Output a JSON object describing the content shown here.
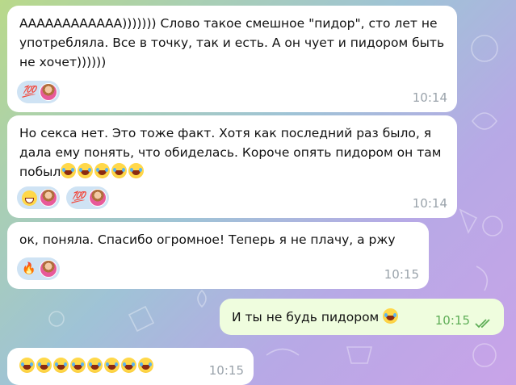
{
  "chat": {
    "messages": [
      {
        "direction": "incoming",
        "text": "АААААААААААА))))))) Слово такое смешное \"пидор\", сто лет не употребляла. Все в точку, так и есть. А он чует и пидором быть не хочет))))))",
        "reactions": [
          {
            "emoji_icon": "hundred-points-icon",
            "glyph": "💯"
          }
        ],
        "time": "10:14"
      },
      {
        "direction": "incoming",
        "text": "Но секса нет. Это тоже факт. Хотя как последний раз было, я дала ему понять, что обиделась. Короче опять пидором он там побыл",
        "trailing_emoji": {
          "icon": "face-with-tears-of-joy-icon",
          "count": 5
        },
        "reactions": [
          {
            "emoji_icon": "grinning-face-icon",
            "glyph": "😁"
          },
          {
            "emoji_icon": "hundred-points-icon",
            "glyph": "💯"
          }
        ],
        "time": "10:14"
      },
      {
        "direction": "incoming",
        "text": "ок, поняла. Спасибо огромное! Теперь я не плачу, а ржу",
        "reactions": [
          {
            "emoji_icon": "fire-icon",
            "glyph": "🔥"
          }
        ],
        "time": "10:15"
      },
      {
        "direction": "outgoing",
        "text": "И ты не будь пидором",
        "trailing_emoji": {
          "icon": "face-with-tears-of-joy-icon",
          "count": 1
        },
        "time": "10:15",
        "status_icon": "double-check-read-icon"
      },
      {
        "direction": "incoming",
        "text": "",
        "trailing_emoji": {
          "icon": "face-with-tears-of-joy-icon",
          "count": 8
        },
        "time": "10:15"
      }
    ]
  },
  "colors": {
    "incoming_bubble": "#ffffff",
    "outgoing_bubble": "#effdde",
    "reaction_pill": "#cfe3f4",
    "time_incoming": "#9aa3ab",
    "time_outgoing": "#5fae57"
  }
}
